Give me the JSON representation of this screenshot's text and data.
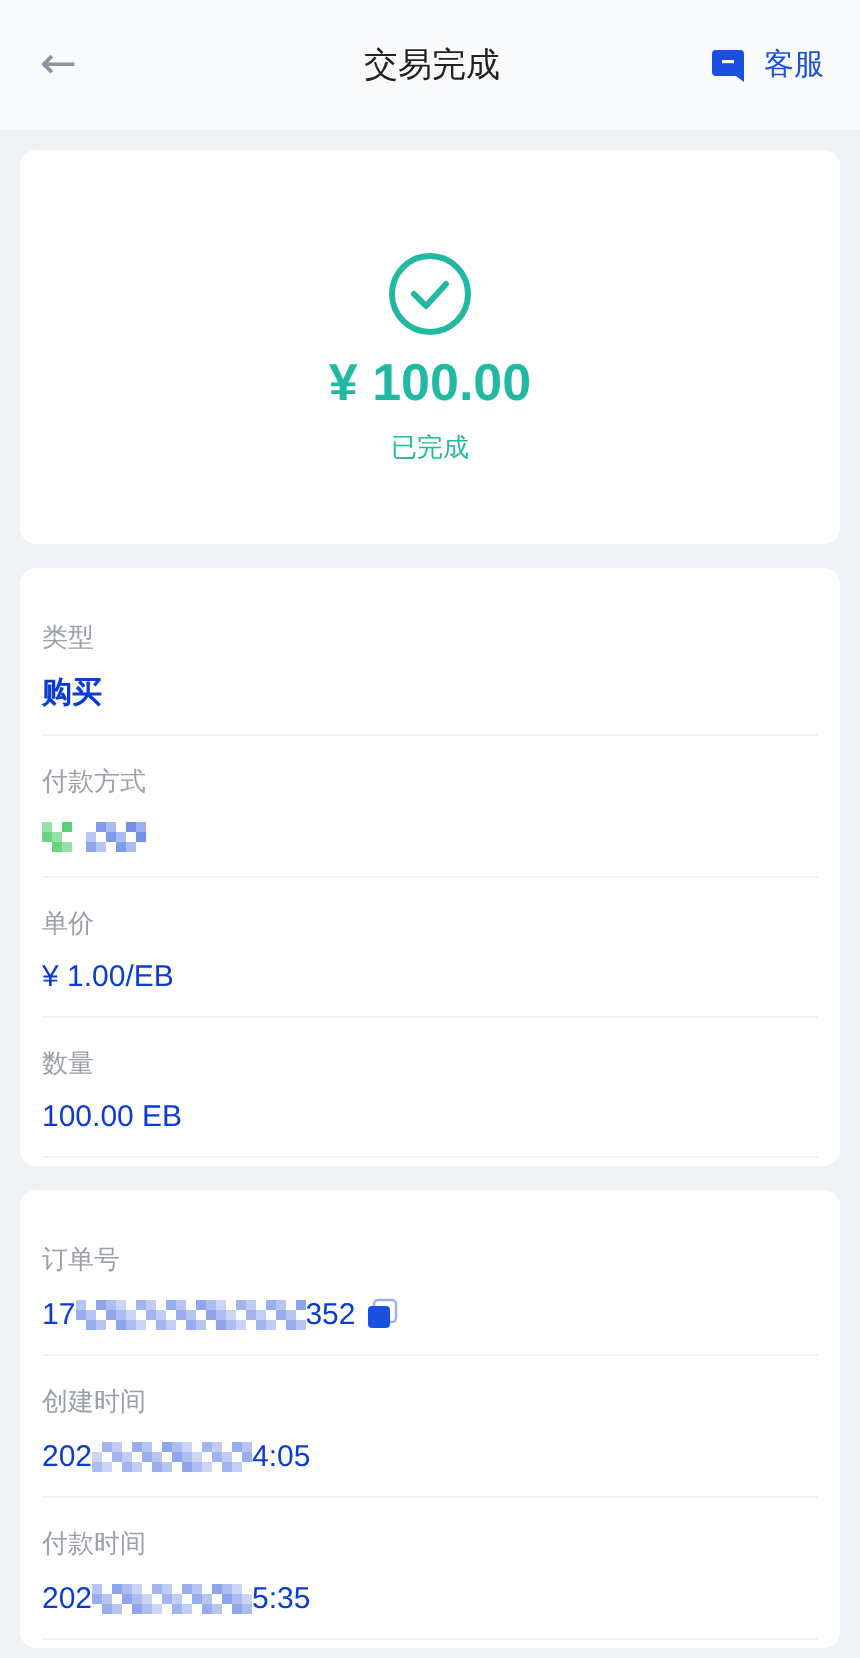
{
  "header": {
    "back": "←",
    "title": "交易完成",
    "service": "客服"
  },
  "summary": {
    "amount": "¥ 100.00",
    "status": "已完成",
    "completed": true
  },
  "details": [
    {
      "kind": "text",
      "label": "类型",
      "value": "购买",
      "bold": true
    },
    {
      "kind": "redacted",
      "label": "付款方式"
    },
    {
      "kind": "text",
      "label": "单价",
      "value": "¥ 1.00/EB",
      "bold": false
    },
    {
      "kind": "text",
      "label": "数量",
      "value": "100.00 EB",
      "bold": false
    }
  ],
  "order": [
    {
      "kind": "partial",
      "label": "订单号",
      "value_start": "17",
      "value_end": "352",
      "copyable": true
    },
    {
      "kind": "partial",
      "label": "创建时间",
      "value_start": "202",
      "value_end": "4:05",
      "copyable": false
    },
    {
      "kind": "partial",
      "label": "付款时间",
      "value_start": "202",
      "value_end": "5:35",
      "copyable": false
    }
  ]
}
